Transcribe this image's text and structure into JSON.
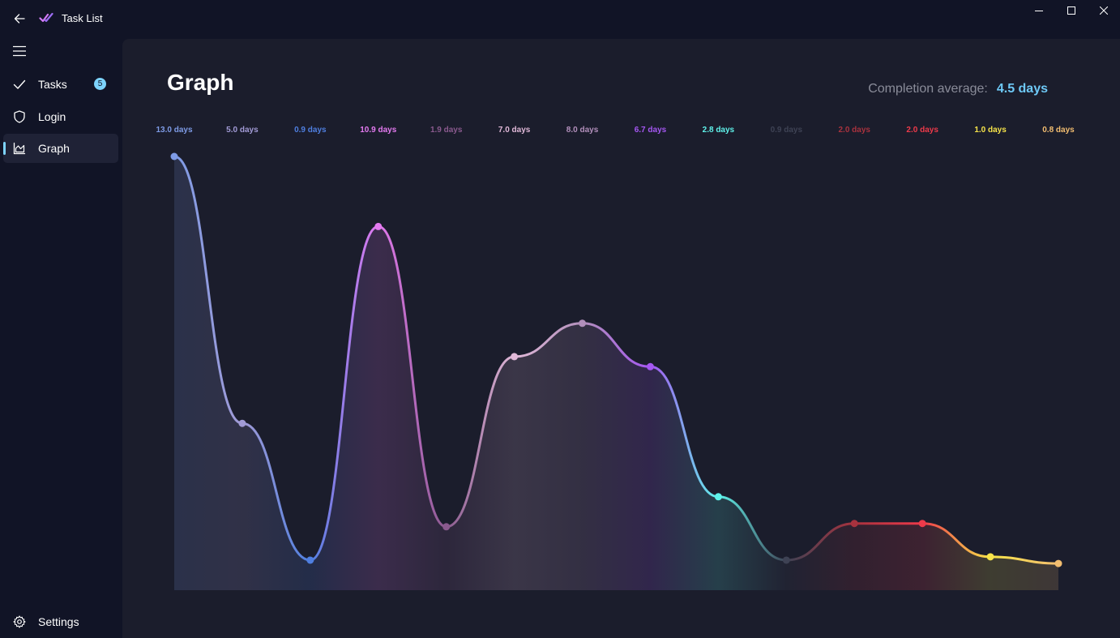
{
  "window": {
    "title": "Task List",
    "controls": {
      "minimize": "minimize-icon",
      "maximize": "maximize-icon",
      "close": "close-icon"
    }
  },
  "nav": {
    "items": [
      {
        "label": "Tasks",
        "icon": "checkmark-icon",
        "badge": "5"
      },
      {
        "label": "Login",
        "icon": "shield-icon"
      },
      {
        "label": "Graph",
        "icon": "area-chart-icon",
        "selected": true
      }
    ],
    "footer": {
      "label": "Settings",
      "icon": "gear-icon"
    }
  },
  "page": {
    "title": "Graph",
    "average_label": "Completion average:",
    "average_value": "4.5 days"
  },
  "colors": {
    "background": "#111426",
    "panel": "#1b1d2c",
    "accent": "#7dd3fc"
  },
  "chart_data": {
    "type": "area",
    "ylim": [
      0,
      13.0
    ],
    "grid": false,
    "labels": [
      "13.0 days",
      "5.0 days",
      "0.9 days",
      "10.9 days",
      "1.9 days",
      "7.0 days",
      "8.0 days",
      "6.7 days",
      "2.8 days",
      "0.9 days",
      "2.0 days",
      "2.0 days",
      "1.0 days",
      "0.8 days"
    ],
    "values": [
      13.0,
      5.0,
      0.9,
      10.9,
      1.9,
      7.0,
      8.0,
      6.7,
      2.8,
      0.9,
      2.0,
      2.0,
      1.0,
      0.8
    ],
    "colors": [
      "#7e9be6",
      "#a29bd6",
      "#4f7fe0",
      "#e47af0",
      "#8a5a8e",
      "#e0b8d8",
      "#b28fbb",
      "#a557f2",
      "#5ff2ea",
      "#3e4254",
      "#a8323e",
      "#ee3a4a",
      "#f7e44a",
      "#f2bd70"
    ]
  }
}
